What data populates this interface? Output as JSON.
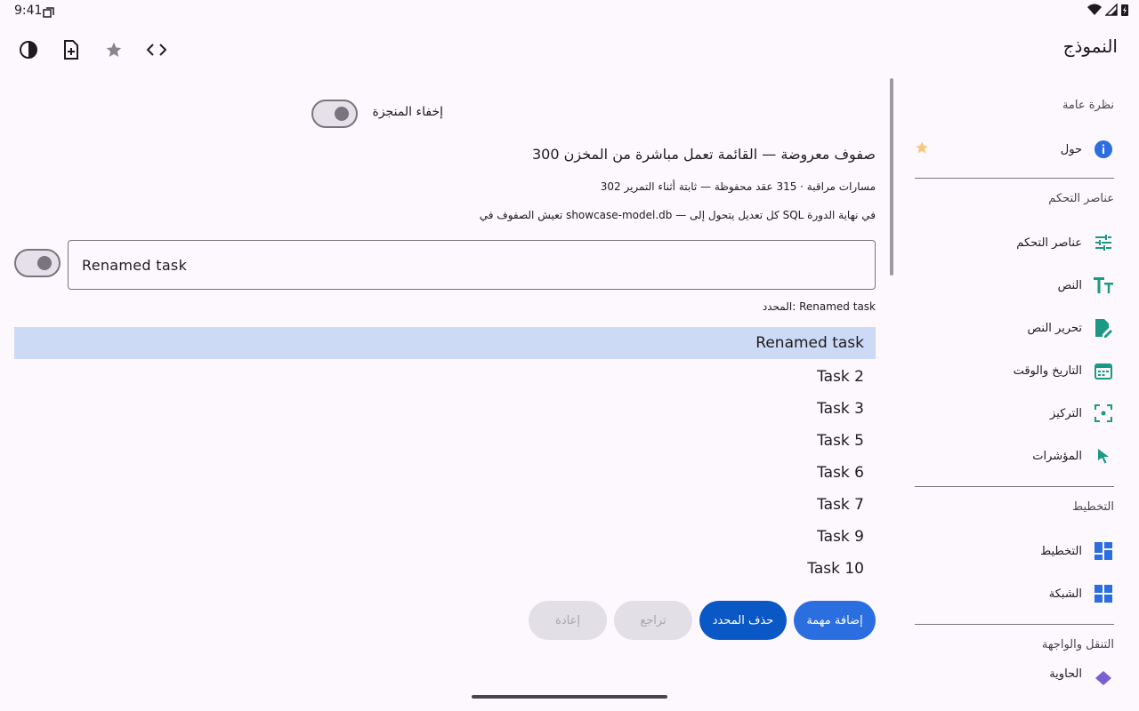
{
  "status": {
    "time": "9:41"
  },
  "app": {
    "title": "النموذج"
  },
  "toolbar": {
    "icons": [
      "contrast-icon",
      "new-file-icon",
      "star-icon",
      "code-icon"
    ]
  },
  "sidebar": {
    "sections": [
      {
        "header": "نظرة عامة",
        "items": [
          {
            "label": "حول",
            "icon": "info-icon"
          }
        ]
      },
      {
        "header": "عناصر التحكم",
        "items": [
          {
            "label": "عناصر التحكم",
            "icon": "tune-icon"
          },
          {
            "label": "النص",
            "icon": "text-icon"
          },
          {
            "label": "تحرير النص",
            "icon": "edit-document-icon"
          },
          {
            "label": "التاريخ والوقت",
            "icon": "calendar-icon"
          },
          {
            "label": "التركيز",
            "icon": "focus-icon"
          },
          {
            "label": "المؤشرات",
            "icon": "pointer-icon"
          }
        ]
      },
      {
        "header": "التخطيط",
        "items": [
          {
            "label": "التخطيط",
            "icon": "layout-icon"
          },
          {
            "label": "الشبكة",
            "icon": "grid-icon"
          }
        ]
      },
      {
        "header": "التنقل والواجهة",
        "items": [
          {
            "label": "الحاوية",
            "icon": "nav-icon"
          }
        ]
      }
    ]
  },
  "main": {
    "hide_completed_label": "إخفاء المنجزة",
    "heading": "300 صفوف معروضة — القائمة تعمل مباشرة من المخزن",
    "stats": "302 مسارات مراقبة · 315 عقد محفوظة — ثابتة أثناء التمرير",
    "storage_note": "تعيش الصفوف في showcase-model.db — كل تعديل يتحول إلى SQL في نهاية الدورة",
    "input_value": "Renamed task",
    "selected_label": "المحدد: Renamed task",
    "tasks": [
      "Renamed task",
      "Task 2",
      "Task 3",
      "Task 5",
      "Task 6",
      "Task 7",
      "Task 9",
      "Task 10"
    ],
    "buttons": {
      "add": "إضافة مهمة",
      "delete": "حذف المحدد",
      "undo": "تراجع",
      "redo": "إعادة"
    }
  },
  "colors": {
    "accent": "#2a6ee0",
    "selection": "#cddaf5",
    "background": "#fdf7fe"
  }
}
